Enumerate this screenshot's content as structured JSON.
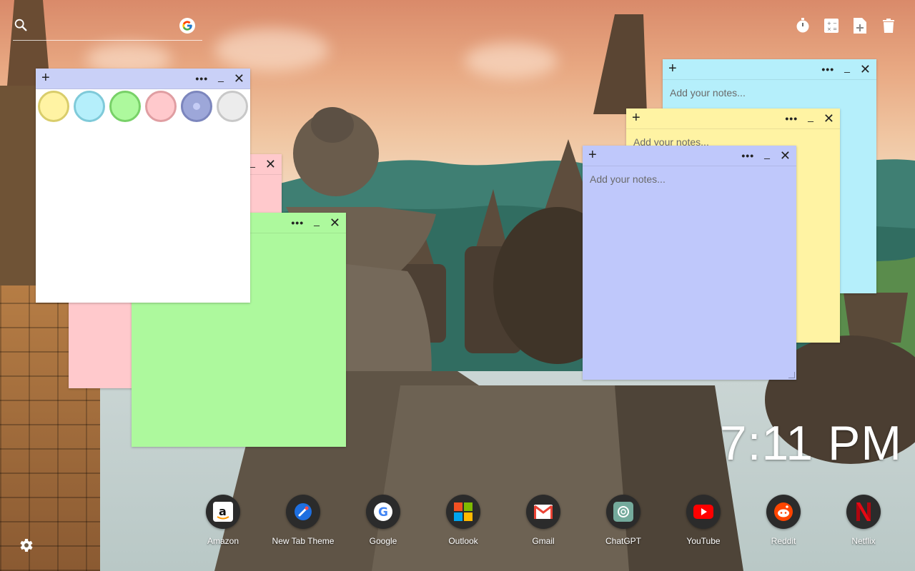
{
  "search": {
    "value": "",
    "placeholder": ""
  },
  "toolbar": {
    "icons": [
      "timer-icon",
      "calculator-icon",
      "add-file-icon",
      "trash-icon"
    ]
  },
  "notes": [
    {
      "id": "palette-note",
      "color": "#ffffff",
      "header": "#c9d0f7",
      "plus": "+",
      "dots": "•••",
      "min": "_",
      "close": "✕"
    },
    {
      "id": "pink-note",
      "color": "#ffc9cc",
      "header": "#ffc9cc",
      "plus": "+",
      "dots": "•••",
      "min": "_",
      "close": "✕"
    },
    {
      "id": "green-note",
      "color": "#adf99d",
      "header": "#adf99d",
      "plus": "+",
      "dots": "•••",
      "min": "_",
      "close": "✕"
    },
    {
      "id": "cyan-note",
      "color": "#b5effb",
      "header": "#b5effb",
      "plus": "+",
      "dots": "•••",
      "min": "_",
      "close": "✕",
      "placeholder": "Add your notes..."
    },
    {
      "id": "yellow-note",
      "color": "#fff3a3",
      "header": "#fff3a3",
      "plus": "+",
      "dots": "•••",
      "min": "_",
      "close": "✕",
      "placeholder": "Add your notes..."
    },
    {
      "id": "blue-note",
      "color": "#bfc8fb",
      "header": "#bfc8fb",
      "plus": "+",
      "dots": "•••",
      "min": "_",
      "close": "✕",
      "placeholder": "Add your notes..."
    }
  ],
  "palette": [
    {
      "name": "yellow",
      "fill": "#fff3a3",
      "ring": "#d9cd6b"
    },
    {
      "name": "cyan",
      "fill": "#b5effb",
      "ring": "#7fcad9"
    },
    {
      "name": "green",
      "fill": "#adf99d",
      "ring": "#78d168"
    },
    {
      "name": "pink",
      "fill": "#ffc9cc",
      "ring": "#e09ea2"
    },
    {
      "name": "blue",
      "fill": "#9da7d9",
      "ring": "#7c86bd",
      "selected": true
    },
    {
      "name": "white",
      "fill": "#ececec",
      "ring": "#c8c8c8"
    }
  ],
  "clock": "7:11 PM",
  "dock": [
    {
      "label": "Amazon",
      "icon": "amazon-icon"
    },
    {
      "label": "New Tab Theme",
      "icon": "new-tab-theme-icon"
    },
    {
      "label": "Google",
      "icon": "google-icon"
    },
    {
      "label": "Outlook",
      "icon": "outlook-icon"
    },
    {
      "label": "Gmail",
      "icon": "gmail-icon"
    },
    {
      "label": "ChatGPT",
      "icon": "chatgpt-icon"
    },
    {
      "label": "YouTube",
      "icon": "youtube-icon"
    },
    {
      "label": "Reddit",
      "icon": "reddit-icon"
    },
    {
      "label": "Netflix",
      "icon": "netflix-icon"
    }
  ]
}
